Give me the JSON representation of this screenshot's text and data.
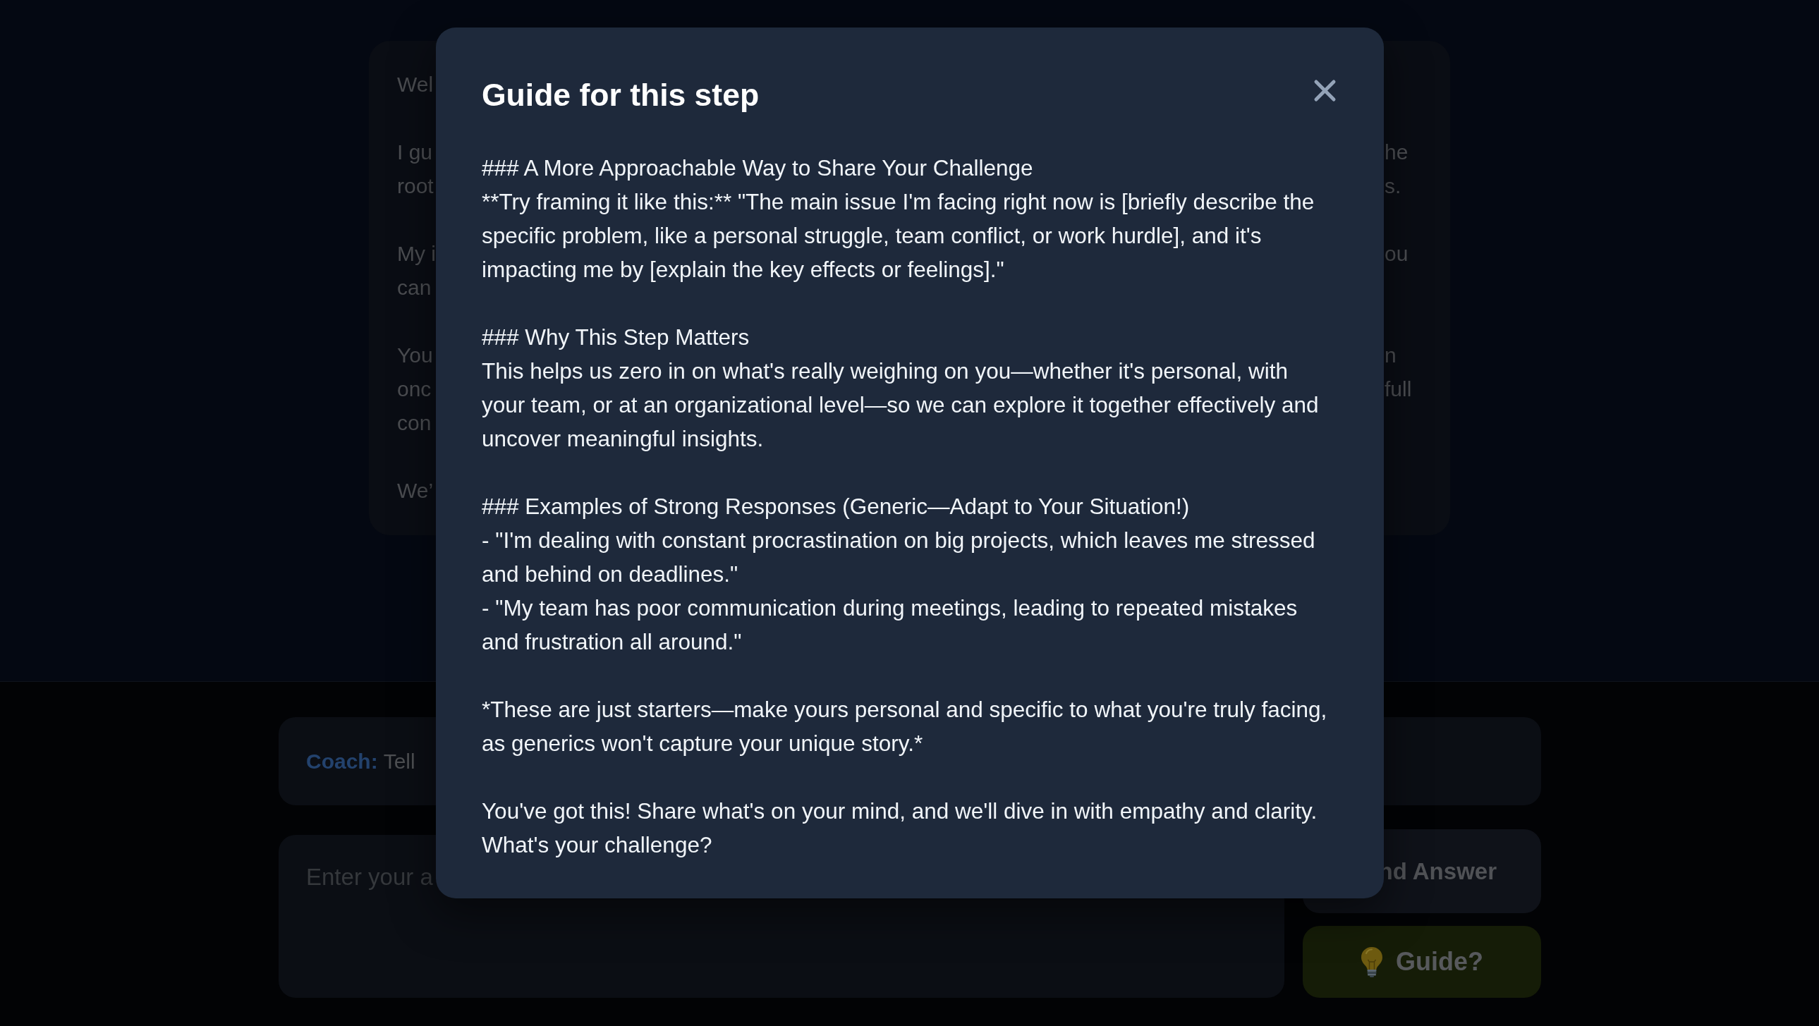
{
  "intro_card": {
    "paragraphs": [
      {
        "lines": [
          {
            "start": "Wel"
          }
        ]
      },
      {
        "lines": [
          {
            "start": "I gu",
            "end": "he"
          },
          {
            "start": "root",
            "end": "s."
          }
        ]
      },
      {
        "lines": [
          {
            "start": "My i",
            "end": "ou"
          },
          {
            "start": "can"
          }
        ]
      },
      {
        "lines": [
          {
            "start": "You",
            "end": "n"
          },
          {
            "start": "onc",
            "end": "full"
          },
          {
            "start": "con"
          }
        ]
      },
      {
        "lines": [
          {
            "start": "We’"
          }
        ]
      }
    ]
  },
  "coach_message": {
    "speaker": "Coach:",
    "text": "Tell"
  },
  "answer_field": {
    "placeholder": "Enter your a"
  },
  "send_button": {
    "label": "nd Answer"
  },
  "guide_button": {
    "label": "Guide?"
  },
  "guide_modal": {
    "title": "Guide for this step",
    "sections": [
      {
        "heading": "### A More Approachable Way to Share Your Challenge",
        "lines": [
          "**Try framing it like this:** \"The main issue I'm facing right now is [briefly describe the specific problem, like a personal struggle, team conflict, or work hurdle], and it's impacting me by [explain the key effects or feelings].\""
        ]
      },
      {
        "heading": "### Why This Step Matters",
        "lines": [
          "This helps us zero in on what's really weighing on you—whether it's personal, with your team, or at an organizational level—so we can explore it together effectively and uncover meaningful insights."
        ]
      },
      {
        "heading": "### Examples of Strong Responses (Generic—Adapt to Your Situation!)",
        "lines": [
          "- \"I'm dealing with constant procrastination on big projects, which leaves me stressed and behind on deadlines.\"",
          "- \"My team has poor communication during meetings, leading to repeated mistakes and frustration all around.\""
        ]
      },
      {
        "lines": [
          "*These are just starters—make yours personal and specific to what you're truly facing, as generics won't capture your unique story.*"
        ]
      },
      {
        "lines": [
          "You've got this! Share what's on your mind, and we'll dive in with empathy and clarity. What's your challenge?"
        ]
      }
    ]
  }
}
